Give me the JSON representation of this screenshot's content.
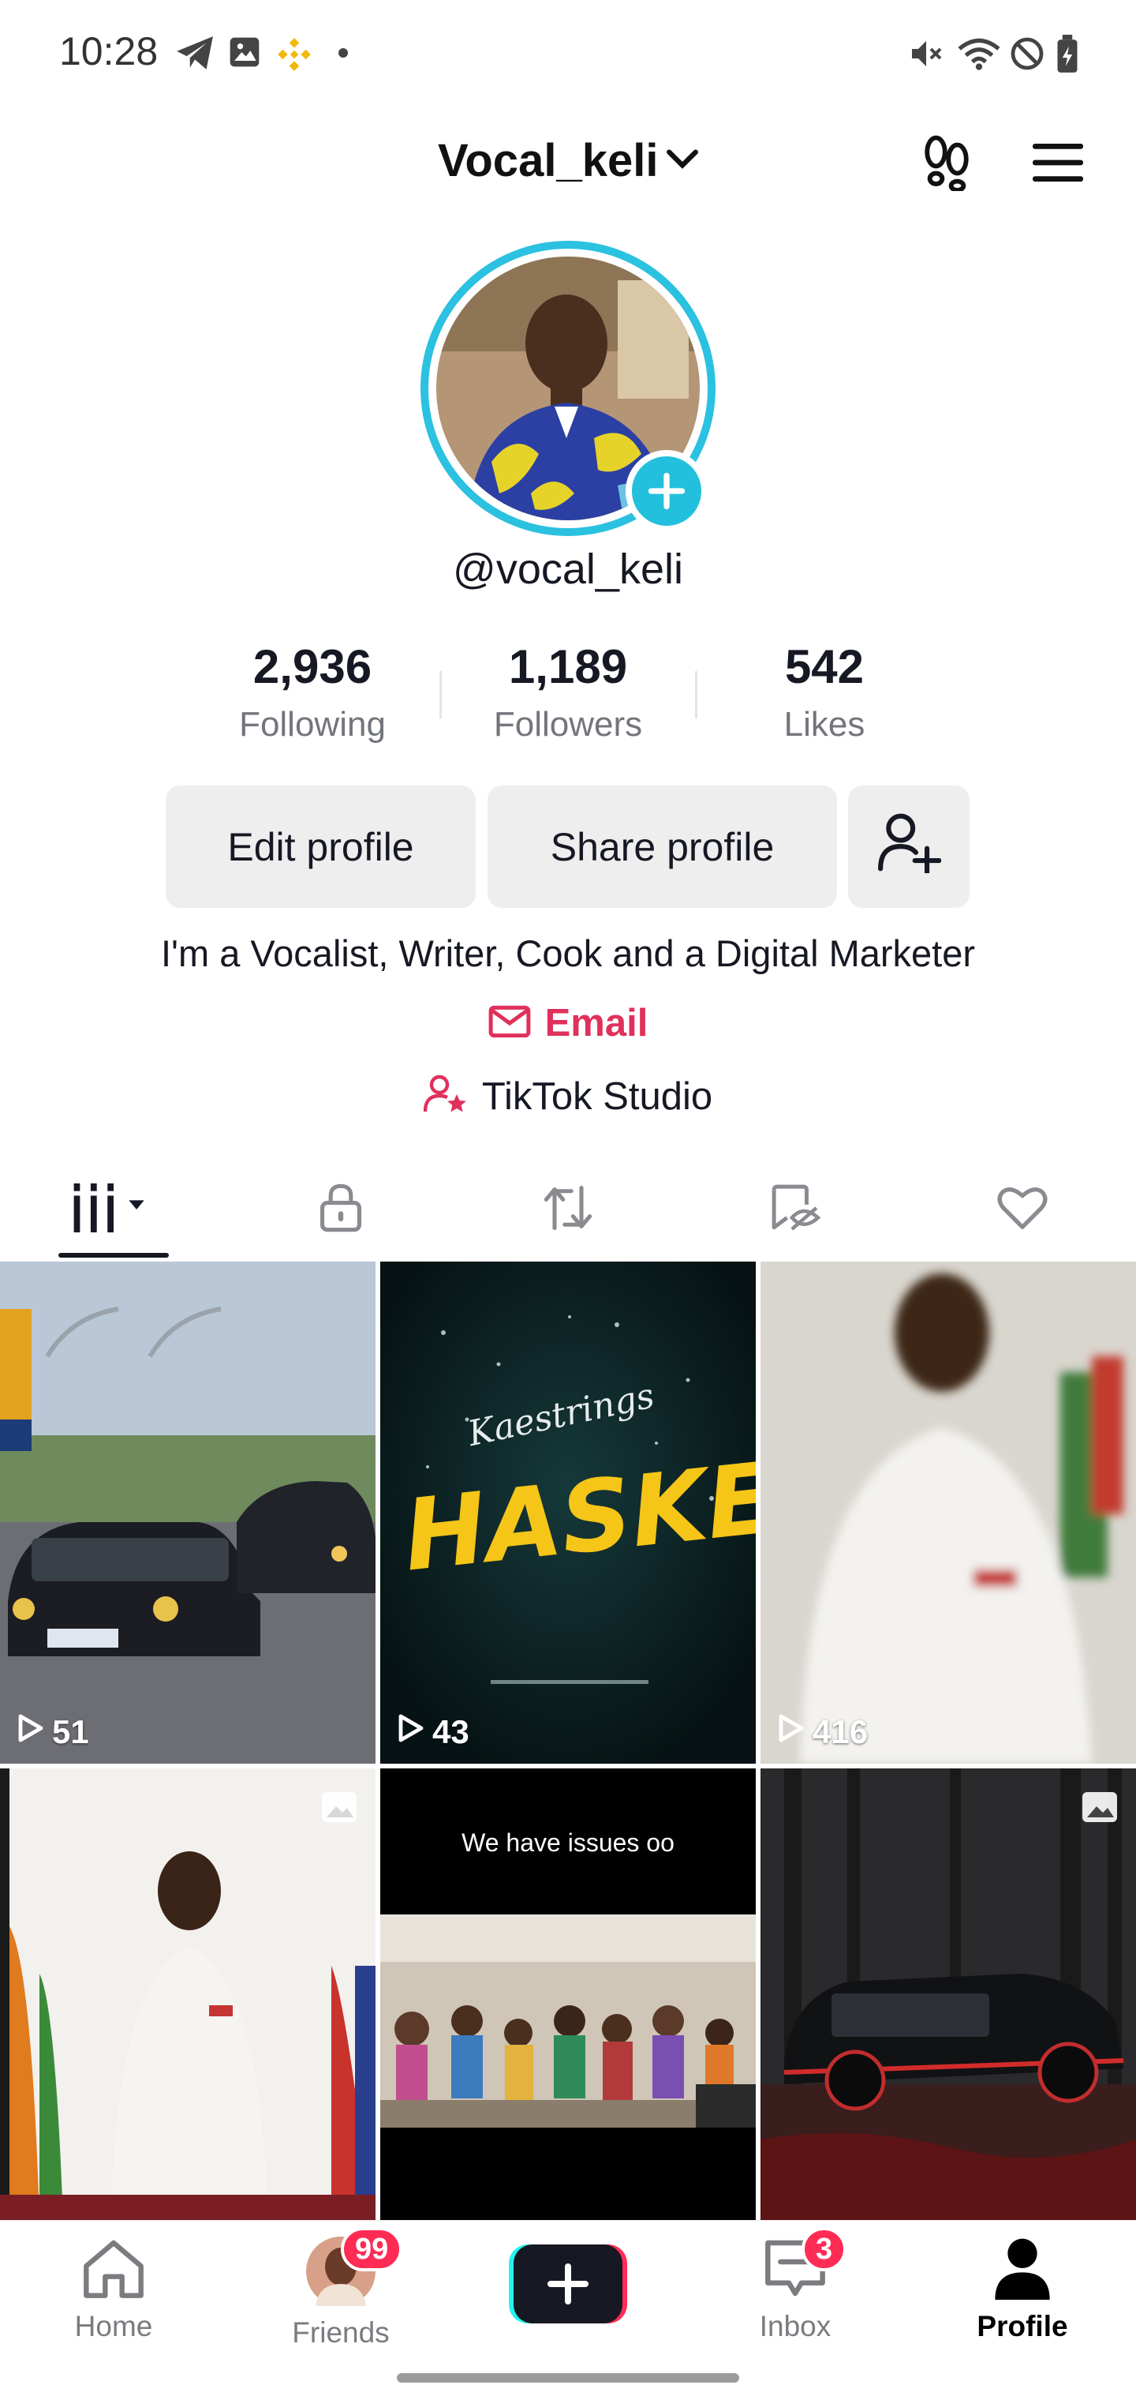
{
  "status_bar": {
    "time": "10:28"
  },
  "header": {
    "username": "Vocal_keli"
  },
  "profile": {
    "handle": "@vocal_keli",
    "stats": [
      {
        "value": "2,936",
        "label": "Following"
      },
      {
        "value": "1,189",
        "label": "Followers"
      },
      {
        "value": "542",
        "label": "Likes"
      }
    ],
    "edit_label": "Edit profile",
    "share_label": "Share profile",
    "bio": "I'm a Vocalist, Writer, Cook and a Digital Marketer",
    "email_label": "Email",
    "studio_label": "TikTok Studio"
  },
  "grid": {
    "views": [
      "51",
      "43",
      "416"
    ],
    "haske_subtitle": "Kaestrings",
    "haske_title": "HASKE",
    "issues_caption": "We have issues oo"
  },
  "nav": {
    "home": "Home",
    "friends": "Friends",
    "friends_badge": "99",
    "inbox": "Inbox",
    "inbox_badge": "3",
    "profile": "Profile"
  },
  "colors": {
    "accent_pink": "#e0305b",
    "ring_cyan": "#2bc1e0",
    "badge_red": "#fe2c55"
  }
}
